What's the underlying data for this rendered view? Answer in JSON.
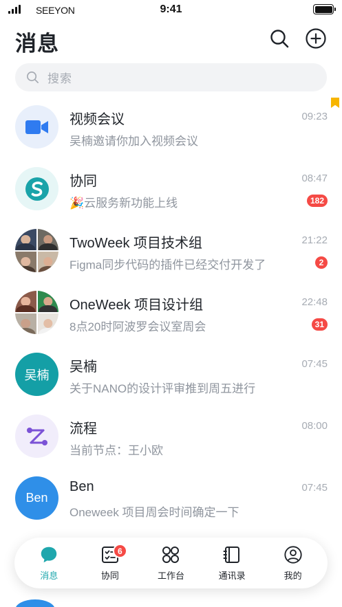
{
  "status_bar": {
    "carrier": "SEEYON",
    "time": "9:41"
  },
  "header": {
    "title": "消息"
  },
  "search": {
    "placeholder": "搜索"
  },
  "messages": [
    {
      "title": "视频会议",
      "subtitle": "吴楠邀请你加入视频会议",
      "time": "09:23",
      "badge": "",
      "avatar": "video-camera-icon",
      "avatar_bg": "#e8effb"
    },
    {
      "title": "协同",
      "subtitle": "🎉云服务新功能上线",
      "time": "08:47",
      "badge": "182",
      "avatar": "collaboration-logo-icon",
      "avatar_bg": "#e6f6f6"
    },
    {
      "title": "TwoWeek 项目技术组",
      "subtitle": "Figma同步代码的插件已经交付开发了",
      "time": "21:22",
      "badge": "2",
      "avatar": "group-avatar"
    },
    {
      "title": "OneWeek 项目设计组",
      "subtitle": "8点20时阿波罗会议室周会",
      "time": "22:48",
      "badge": "31",
      "avatar": "group-avatar"
    },
    {
      "title": "吴楠",
      "subtitle": "关于NANO的设计评审推到周五进行",
      "time": "07:45",
      "badge": "",
      "avatar_text": "吴楠",
      "avatar_bg": "#149fa6"
    },
    {
      "title": "流程",
      "subtitle": "当前节点：王小欧",
      "time": "08:00",
      "badge": "",
      "avatar": "workflow-icon",
      "avatar_bg": "#f1edfb"
    },
    {
      "title": "Ben",
      "subtitle": "Oneweek 项目周会时间确定一下",
      "time": "07:45",
      "badge": "",
      "avatar_text": "Ben",
      "avatar_bg": "#2f8fe8"
    }
  ],
  "nav": {
    "tabs": [
      {
        "label": "消息",
        "icon": "chat-bubble-icon",
        "active": true
      },
      {
        "label": "协同",
        "icon": "checklist-icon",
        "badge": "6"
      },
      {
        "label": "工作台",
        "icon": "apps-grid-icon"
      },
      {
        "label": "通讯录",
        "icon": "contacts-book-icon"
      },
      {
        "label": "我的",
        "icon": "profile-icon"
      }
    ]
  },
  "colors": {
    "accent": "#1fa7ad",
    "badge": "#f54a45",
    "bookmark": "#f7b500"
  }
}
